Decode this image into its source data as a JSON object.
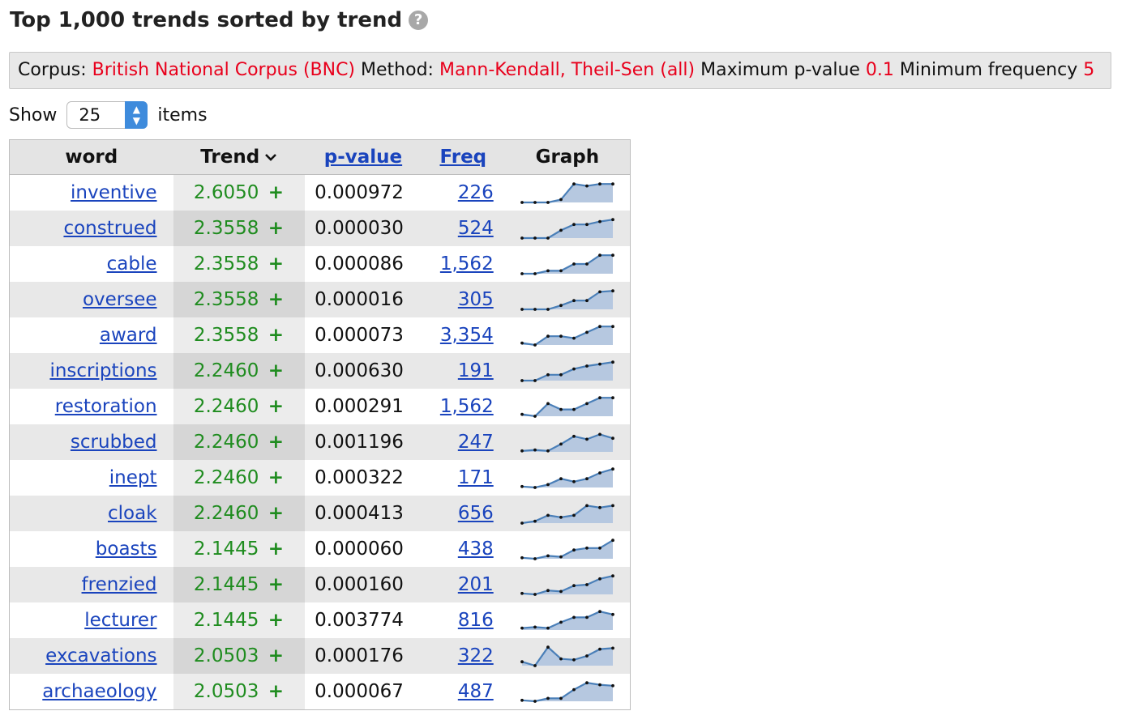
{
  "title": "Top 1,000 trends sorted by trend",
  "help_icon": "question-circle-icon",
  "info": {
    "corpus_label": "Corpus:",
    "corpus_value": "British National Corpus (BNC)",
    "method_label": "Method:",
    "method_value": "Mann-Kendall, Theil-Sen (all)",
    "maxp_label": "Maximum p-value",
    "maxp_value": "0.1",
    "minfreq_label": "Minimum frequency",
    "minfreq_value": "5"
  },
  "show": {
    "label_before": "Show",
    "selected": "25",
    "label_after": "items"
  },
  "table": {
    "headers": {
      "word": "word",
      "trend": "Trend",
      "pvalue": "p-value",
      "freq": "Freq",
      "graph": "Graph"
    },
    "rows": [
      {
        "word": "inventive",
        "trend": "2.6050",
        "sign": "+",
        "pvalue": "0.000972",
        "freq": "226",
        "series": [
          0,
          0,
          0,
          0.15,
          0.95,
          0.85,
          0.95,
          0.95
        ]
      },
      {
        "word": "construed",
        "trend": "2.3558",
        "sign": "+",
        "pvalue": "0.000030",
        "freq": "524",
        "series": [
          0,
          0,
          0,
          0.4,
          0.7,
          0.7,
          0.85,
          0.95
        ]
      },
      {
        "word": "cable",
        "trend": "2.3558",
        "sign": "+",
        "pvalue": "0.000086",
        "freq": "1,562",
        "series": [
          0,
          0,
          0.15,
          0.15,
          0.5,
          0.5,
          0.95,
          0.95
        ]
      },
      {
        "word": "oversee",
        "trend": "2.3558",
        "sign": "+",
        "pvalue": "0.000016",
        "freq": "305",
        "series": [
          0,
          0,
          0,
          0.2,
          0.45,
          0.45,
          0.9,
          0.95
        ]
      },
      {
        "word": "award",
        "trend": "2.3558",
        "sign": "+",
        "pvalue": "0.000073",
        "freq": "3,354",
        "series": [
          0.1,
          0,
          0.45,
          0.45,
          0.35,
          0.65,
          0.95,
          0.95
        ]
      },
      {
        "word": "inscriptions",
        "trend": "2.2460",
        "sign": "+",
        "pvalue": "0.000630",
        "freq": "191",
        "series": [
          0,
          0,
          0.3,
          0.3,
          0.6,
          0.75,
          0.85,
          0.95
        ]
      },
      {
        "word": "restoration",
        "trend": "2.2460",
        "sign": "+",
        "pvalue": "0.000291",
        "freq": "1,562",
        "series": [
          0.1,
          0,
          0.65,
          0.35,
          0.35,
          0.65,
          0.95,
          0.95
        ]
      },
      {
        "word": "scrubbed",
        "trend": "2.2460",
        "sign": "+",
        "pvalue": "0.001196",
        "freq": "247",
        "series": [
          0.05,
          0.1,
          0.05,
          0.4,
          0.8,
          0.65,
          0.9,
          0.7
        ]
      },
      {
        "word": "inept",
        "trend": "2.2460",
        "sign": "+",
        "pvalue": "0.000322",
        "freq": "171",
        "series": [
          0.05,
          0,
          0.15,
          0.45,
          0.3,
          0.45,
          0.75,
          0.95
        ]
      },
      {
        "word": "cloak",
        "trend": "2.2460",
        "sign": "+",
        "pvalue": "0.000413",
        "freq": "656",
        "series": [
          0,
          0.1,
          0.4,
          0.3,
          0.4,
          0.9,
          0.8,
          0.9
        ]
      },
      {
        "word": "boasts",
        "trend": "2.1445",
        "sign": "+",
        "pvalue": "0.000060",
        "freq": "438",
        "series": [
          0.05,
          0,
          0.15,
          0.1,
          0.45,
          0.55,
          0.55,
          0.95
        ]
      },
      {
        "word": "frenzied",
        "trend": "2.1445",
        "sign": "+",
        "pvalue": "0.000160",
        "freq": "201",
        "series": [
          0.05,
          0,
          0.2,
          0.15,
          0.45,
          0.5,
          0.8,
          0.95
        ]
      },
      {
        "word": "lecturer",
        "trend": "2.1445",
        "sign": "+",
        "pvalue": "0.003774",
        "freq": "816",
        "series": [
          0.1,
          0.15,
          0.1,
          0.4,
          0.65,
          0.65,
          0.95,
          0.8
        ]
      },
      {
        "word": "excavations",
        "trend": "2.0503",
        "sign": "+",
        "pvalue": "0.000176",
        "freq": "322",
        "series": [
          0.2,
          0,
          0.95,
          0.35,
          0.3,
          0.5,
          0.85,
          0.9
        ]
      },
      {
        "word": "archaeology",
        "trend": "2.0503",
        "sign": "+",
        "pvalue": "0.000067",
        "freq": "487",
        "series": [
          0.05,
          0,
          0.15,
          0.15,
          0.6,
          0.95,
          0.85,
          0.8
        ]
      }
    ]
  },
  "colors": {
    "red": "#e8001c",
    "green": "#1f8c1f",
    "link": "#1a44bd",
    "spark_fill": "#b6c8e0",
    "spark_line": "#4a7fb8"
  }
}
